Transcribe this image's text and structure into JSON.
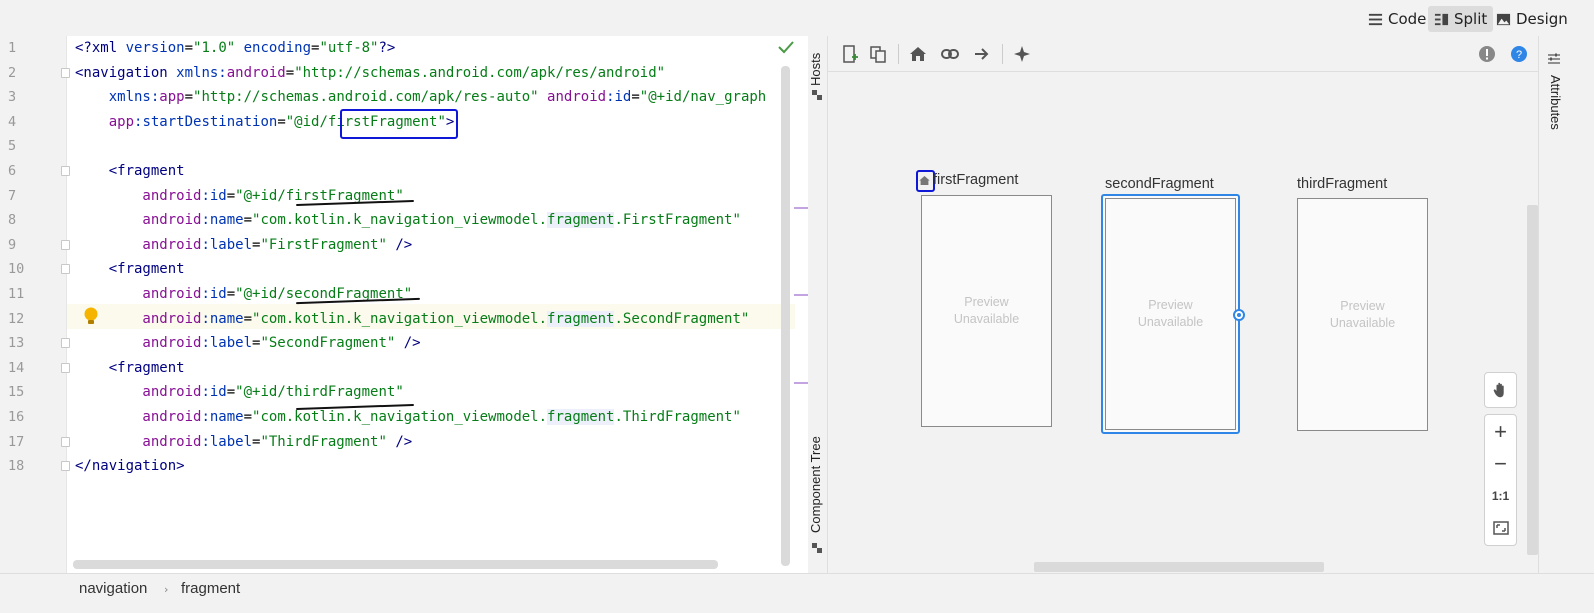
{
  "modes": [
    {
      "label": "Code",
      "icon": "lines-icon",
      "active": false
    },
    {
      "label": "Split",
      "icon": "split-icon",
      "active": true
    },
    {
      "label": "Design",
      "icon": "image-icon",
      "active": false
    }
  ],
  "editor": {
    "line_numbers": [
      "1",
      "2",
      "3",
      "4",
      "5",
      "6",
      "7",
      "8",
      "9",
      "10",
      "11",
      "12",
      "13",
      "14",
      "15",
      "16",
      "17",
      "18"
    ],
    "lines": [
      [
        {
          "t": "<?",
          "c": "c-tag"
        },
        {
          "t": "xml ",
          "c": "c-tag"
        },
        {
          "t": "version",
          "c": "c-attr"
        },
        {
          "t": "=",
          "c": "c-plain"
        },
        {
          "t": "\"1.0\" ",
          "c": "c-str"
        },
        {
          "t": "encoding",
          "c": "c-attr"
        },
        {
          "t": "=",
          "c": "c-plain"
        },
        {
          "t": "\"utf-8\"",
          "c": "c-str"
        },
        {
          "t": "?>",
          "c": "c-tag"
        }
      ],
      [
        {
          "t": "<navigation ",
          "c": "c-tag"
        },
        {
          "t": "xmlns:",
          "c": "c-attr"
        },
        {
          "t": "android",
          "c": "c-attr-ns"
        },
        {
          "t": "=",
          "c": "c-plain"
        },
        {
          "t": "\"http://schemas.android.com/apk/res/android\"",
          "c": "c-str"
        }
      ],
      [
        {
          "t": "    xmlns:",
          "c": "c-attr"
        },
        {
          "t": "app",
          "c": "c-attr-ns"
        },
        {
          "t": "=",
          "c": "c-plain"
        },
        {
          "t": "\"http://schemas.android.com/apk/res-auto\" ",
          "c": "c-str"
        },
        {
          "t": "android",
          "c": "c-attr-ns"
        },
        {
          "t": ":id",
          "c": "c-attr"
        },
        {
          "t": "=",
          "c": "c-plain"
        },
        {
          "t": "\"@+id/nav_graph",
          "c": "c-str"
        }
      ],
      [
        {
          "t": "    app",
          "c": "c-attr-ns"
        },
        {
          "t": ":startDestination",
          "c": "c-attr"
        },
        {
          "t": "=",
          "c": "c-plain"
        },
        {
          "t": "\"@id/firstFragment\"",
          "c": "c-str"
        },
        {
          "t": ">",
          "c": "c-tag"
        }
      ],
      [],
      [
        {
          "t": "    <fragment",
          "c": "c-tag"
        }
      ],
      [
        {
          "t": "        android",
          "c": "c-attr-ns"
        },
        {
          "t": ":id",
          "c": "c-attr"
        },
        {
          "t": "=",
          "c": "c-plain"
        },
        {
          "t": "\"@+id/firstFragment\"",
          "c": "c-str"
        }
      ],
      [
        {
          "t": "        android",
          "c": "c-attr-ns"
        },
        {
          "t": ":name",
          "c": "c-attr"
        },
        {
          "t": "=",
          "c": "c-plain"
        },
        {
          "t": "\"com.kotlin.k_navigation_viewmodel.",
          "c": "c-str"
        },
        {
          "t": "fragment",
          "c": "c-str c-hl"
        },
        {
          "t": ".FirstFragment\"",
          "c": "c-str"
        }
      ],
      [
        {
          "t": "        android",
          "c": "c-attr-ns"
        },
        {
          "t": ":label",
          "c": "c-attr"
        },
        {
          "t": "=",
          "c": "c-plain"
        },
        {
          "t": "\"FirstFragment\" ",
          "c": "c-str"
        },
        {
          "t": "/>",
          "c": "c-tag"
        }
      ],
      [
        {
          "t": "    <fragment",
          "c": "c-tag"
        }
      ],
      [
        {
          "t": "        android",
          "c": "c-attr-ns"
        },
        {
          "t": ":id",
          "c": "c-attr"
        },
        {
          "t": "=",
          "c": "c-plain"
        },
        {
          "t": "\"@+id/secondFragment\"",
          "c": "c-str"
        }
      ],
      [
        {
          "t": "        android",
          "c": "c-attr-ns"
        },
        {
          "t": ":name",
          "c": "c-attr"
        },
        {
          "t": "=",
          "c": "c-plain"
        },
        {
          "t": "\"com.kotlin.k_navigation_viewmodel.",
          "c": "c-str"
        },
        {
          "t": "fragment",
          "c": "c-str c-hl"
        },
        {
          "t": ".SecondFragment\"",
          "c": "c-str"
        }
      ],
      [
        {
          "t": "        android",
          "c": "c-attr-ns"
        },
        {
          "t": ":label",
          "c": "c-attr"
        },
        {
          "t": "=",
          "c": "c-plain"
        },
        {
          "t": "\"SecondFragment\" ",
          "c": "c-str"
        },
        {
          "t": "/>",
          "c": "c-tag"
        }
      ],
      [
        {
          "t": "    <fragment",
          "c": "c-tag"
        }
      ],
      [
        {
          "t": "        android",
          "c": "c-attr-ns"
        },
        {
          "t": ":id",
          "c": "c-attr"
        },
        {
          "t": "=",
          "c": "c-plain"
        },
        {
          "t": "\"@+id/thirdFragment\"",
          "c": "c-str"
        }
      ],
      [
        {
          "t": "        android",
          "c": "c-attr-ns"
        },
        {
          "t": ":name",
          "c": "c-attr"
        },
        {
          "t": "=",
          "c": "c-plain"
        },
        {
          "t": "\"com.kotlin.k_navigation_viewmodel.",
          "c": "c-str"
        },
        {
          "t": "fragment",
          "c": "c-str c-hl"
        },
        {
          "t": ".ThirdFragment\"",
          "c": "c-str"
        }
      ],
      [
        {
          "t": "        android",
          "c": "c-attr-ns"
        },
        {
          "t": ":label",
          "c": "c-attr"
        },
        {
          "t": "=",
          "c": "c-plain"
        },
        {
          "t": "\"ThirdFragment\" ",
          "c": "c-str"
        },
        {
          "t": "/>",
          "c": "c-tag"
        }
      ],
      [
        {
          "t": "</navigation>",
          "c": "c-tag"
        }
      ]
    ]
  },
  "side_tabs": {
    "hosts": "Hosts",
    "component_tree": "Component Tree",
    "attributes": "Attributes"
  },
  "destinations": [
    {
      "label": "firstFragment",
      "preview": "Preview\nUnavailable",
      "start": true,
      "selected": false
    },
    {
      "label": "secondFragment",
      "preview": "Preview\nUnavailable",
      "start": false,
      "selected": true
    },
    {
      "label": "thirdFragment",
      "preview": "Preview\nUnavailable",
      "start": false,
      "selected": false
    }
  ],
  "zoom": {
    "zoom_in": "+",
    "zoom_out": "−",
    "actual_size": "1:1"
  },
  "breadcrumb": [
    "navigation",
    "fragment"
  ],
  "colors": {
    "accent": "#2f86e6",
    "annotation_ink": "#1018d8"
  }
}
